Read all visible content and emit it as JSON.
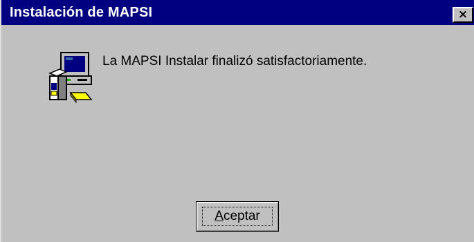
{
  "window": {
    "title": "Instalación de MAPSI",
    "close_label": "×"
  },
  "dialog": {
    "icon": "computer-setup-icon",
    "message": "La MAPSI Instalar finalizó satisfactoriamente."
  },
  "buttons": {
    "ok_mnemonic": "A",
    "ok_rest": "ceptar"
  },
  "colors": {
    "title_bar": "#000080",
    "face": "#c0c0c0"
  }
}
